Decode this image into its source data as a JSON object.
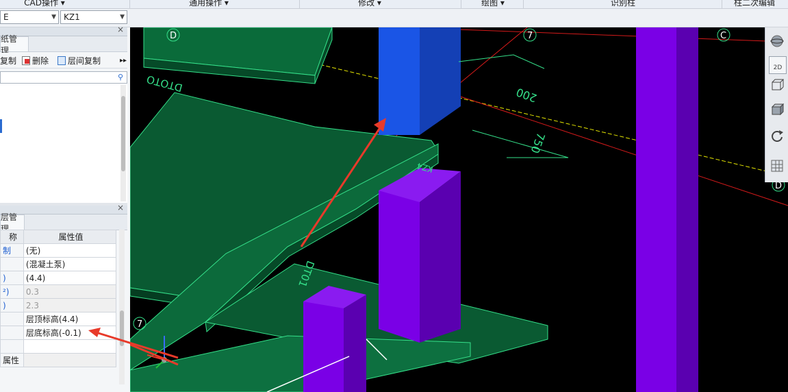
{
  "ribbon": {
    "groups": [
      "CAD操作 ▾",
      "通用操作 ▾",
      "修改 ▾",
      "绘图 ▾",
      "识别柱",
      "柱二次编辑"
    ]
  },
  "toolbar": {
    "combo1_value": "E",
    "combo2_value": "KZ1"
  },
  "drawing_panel": {
    "tab": "纸管理",
    "buttons": {
      "copy": "复制",
      "delete": "删除",
      "floor_copy": "层间复制",
      "more": "▸▸"
    }
  },
  "prop_panel": {
    "tab": "层管理",
    "headers": {
      "name": "称",
      "value": "属性值"
    },
    "rows": [
      {
        "name": "制",
        "value": "(无)",
        "gray": false
      },
      {
        "name": "",
        "value": "(混凝土泵)",
        "gray": false
      },
      {
        "name": ")",
        "value": "(4.4)",
        "gray": false
      },
      {
        "name": "²)",
        "value": "0.3",
        "gray": true
      },
      {
        "name": ")",
        "value": "2.3",
        "gray": true
      },
      {
        "name": "",
        "value": "层顶标高(4.4)",
        "gray": false
      },
      {
        "name": "",
        "value": "层底标高(-0.1)",
        "gray": false
      },
      {
        "name": "",
        "value": "",
        "gray": false
      },
      {
        "name": "属性",
        "value": "",
        "gray": false
      }
    ]
  },
  "viewport": {
    "axis_labels": {
      "d_top": "D",
      "seven_top": "7",
      "c_top": "C",
      "d_right": "D",
      "seven_left": "7"
    },
    "dims": {
      "d1": "200",
      "d2": "750"
    },
    "beam_text": {
      "b1": "DTOTO",
      "b2": "DT01",
      "b3": "KZ4"
    },
    "colors": {
      "background": "#000000",
      "slab": "#0a5a32",
      "slab_edge": "#35e08a",
      "column_blue": "#1a55e6",
      "column_purple": "#7a00e6",
      "arrow": "#e83a2a",
      "yellow_line": "#e6e600",
      "red_line": "#d41a1a"
    }
  },
  "sidebar": {
    "btn_2d": "2D"
  }
}
